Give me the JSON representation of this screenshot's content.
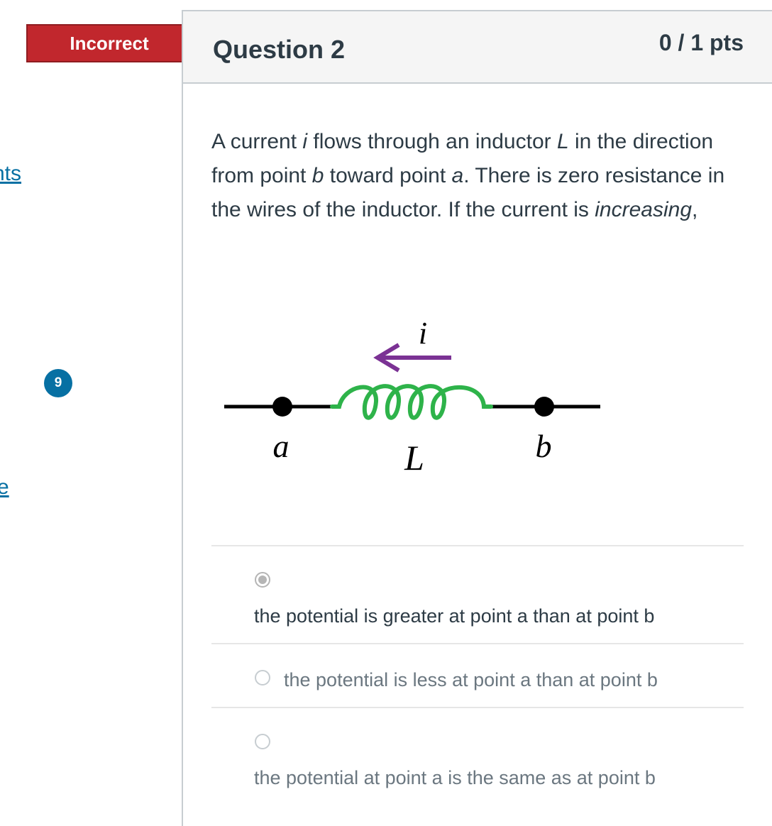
{
  "left_rail": {
    "link1_text": "nts",
    "link2_text": "e",
    "badge_number": "9"
  },
  "flag": {
    "label": "Incorrect",
    "color": "#c1272d"
  },
  "question": {
    "title": "Question 2",
    "points": "0 / 1 pts",
    "text_parts": [
      "A current ",
      "i",
      " flows through an inductor ",
      "L",
      " in the direction from point ",
      "b",
      " toward point ",
      "a",
      ". There is zero resistance in the wires of the inductor. If the current is ",
      "increasing",
      ","
    ]
  },
  "figure": {
    "current_label": "i",
    "inductor_label": "L",
    "point_a_label": "a",
    "point_b_label": "b",
    "arrow_color": "#7b3294",
    "coil_color": "#2eb34a",
    "wire_color": "#000000"
  },
  "answers": [
    {
      "text": "the potential is greater at point a than at point b",
      "selected": true
    },
    {
      "text": "the potential is less at point a than at point b",
      "selected": false
    },
    {
      "text": "the potential at point a is the same as at point b",
      "selected": false
    }
  ]
}
